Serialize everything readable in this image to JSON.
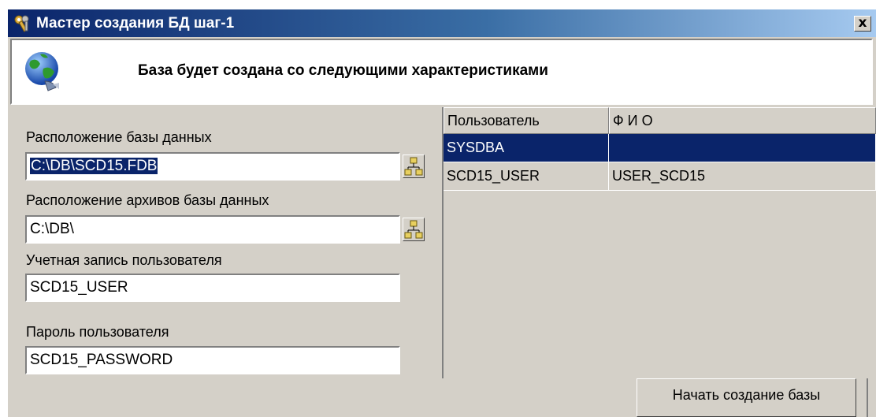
{
  "window": {
    "title": "Мастер создания БД шаг-1",
    "close_label": "x"
  },
  "header": {
    "text": "База будет создана со следующими характеристиками"
  },
  "form": {
    "db_location_label": "Расположение базы данных",
    "db_location_value": "C:\\DB\\SCD15.FDB",
    "archive_location_label": "Расположение архивов базы данных",
    "archive_location_value": "C:\\DB\\",
    "user_account_label": "Учетная запись пользователя",
    "user_account_value": "SCD15_USER",
    "password_label": "Пароль пользователя",
    "password_value": "SCD15_PASSWORD"
  },
  "users_grid": {
    "columns": [
      "Пользователь",
      "Ф И О"
    ],
    "rows": [
      [
        "SYSDBA",
        ""
      ],
      [
        "SCD15_USER",
        "USER_SCD15"
      ]
    ],
    "selected_row": 0
  },
  "footer": {
    "start_button_label": "Начать создание базы"
  },
  "icons": {
    "app": "keys-icon",
    "header": "globe-icon",
    "browse": "network-folder-icon"
  },
  "colors": {
    "title_gradient_start": "#0a246a",
    "title_gradient_end": "#a6caf0",
    "selection": "#0a246a",
    "face": "#d4d0c8"
  }
}
